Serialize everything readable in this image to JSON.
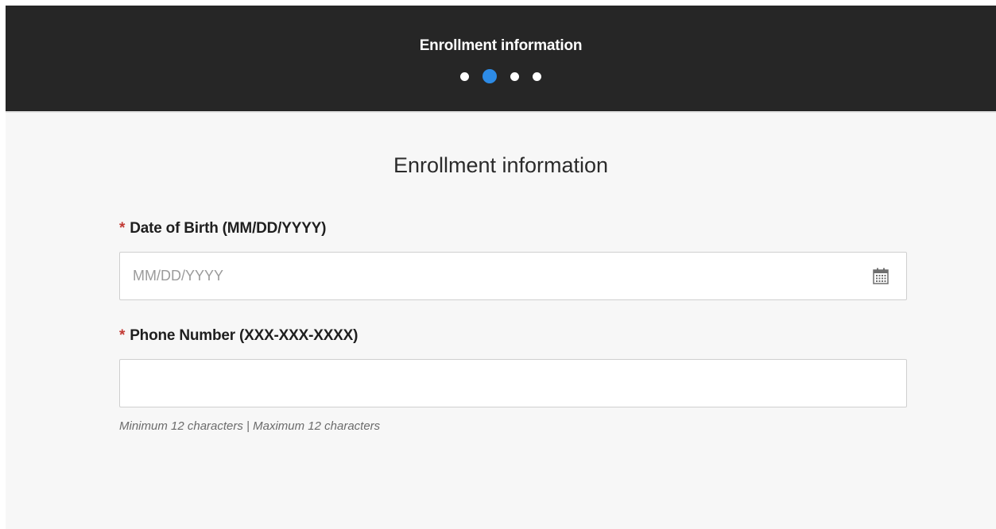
{
  "header": {
    "title": "Enrollment information",
    "steps_total": 4,
    "active_step": 2
  },
  "form": {
    "title": "Enrollment information",
    "fields": [
      {
        "required_marker": "*",
        "label": "Date of Birth (MM/DD/YYYY)",
        "placeholder": "MM/DD/YYYY",
        "value": "",
        "icon": "calendar-icon"
      },
      {
        "required_marker": "*",
        "label": "Phone Number (XXX-XXX-XXXX)",
        "placeholder": "",
        "value": "",
        "helper": "Minimum 12 characters | Maximum 12 characters"
      }
    ]
  },
  "colors": {
    "header_bg": "#262626",
    "active_step": "#2d8be6",
    "required": "#c23934",
    "page_bg": "#f7f7f7"
  }
}
